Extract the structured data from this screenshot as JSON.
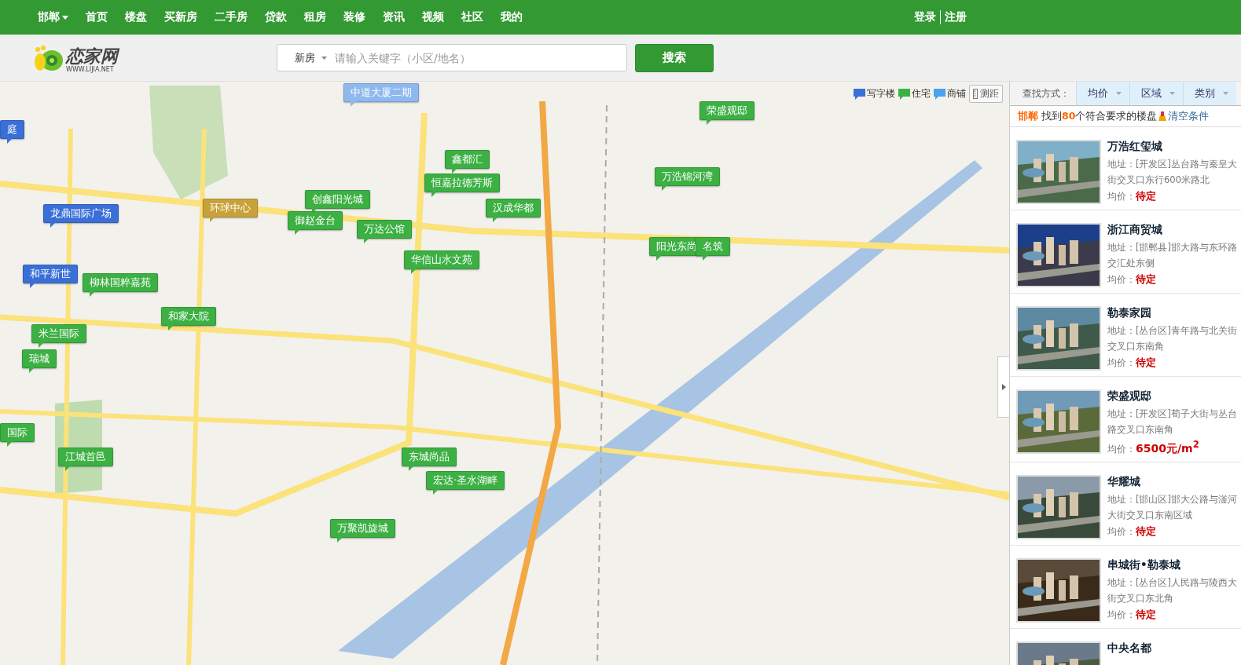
{
  "nav": {
    "city": "邯郸",
    "items": [
      "首页",
      "楼盘",
      "买新房",
      "二手房",
      "贷款",
      "租房",
      "装修",
      "资讯",
      "视频",
      "社区",
      "我的"
    ],
    "login": "登录",
    "register": "注册"
  },
  "header": {
    "logo": "恋家网",
    "logo_sub": "WWW.LIJIA.NET",
    "search_type": "新房",
    "placeholder": "请输入关键字（小区/地名）",
    "search_button": "搜索"
  },
  "map": {
    "legend": [
      {
        "label": "写字楼",
        "color": "#3a6fd8"
      },
      {
        "label": "住宅",
        "color": "#3cb043"
      },
      {
        "label": "商铺",
        "color": "#4aa3f0"
      }
    ],
    "measure": "测距",
    "markers": [
      {
        "label": "中道大厦二期",
        "color": "#8fb8ee"
      },
      {
        "label": "荣盛观邸",
        "color": "#3cb043"
      },
      {
        "label": "庭",
        "color": "#3a6fd8"
      },
      {
        "label": "万浩锦河湾",
        "color": "#3cb043"
      },
      {
        "label": "鑫都汇",
        "color": "#3cb043"
      },
      {
        "label": "恒嘉拉德芳斯",
        "color": "#3cb043"
      },
      {
        "label": "创鑫阳光城",
        "color": "#3cb043"
      },
      {
        "label": "环球中心",
        "color": "#c9a13a"
      },
      {
        "label": "龙鼎国际广场",
        "color": "#3a6fd8"
      },
      {
        "label": "汉成华都",
        "color": "#3cb043"
      },
      {
        "label": "御赵金台",
        "color": "#3cb043"
      },
      {
        "label": "万达公馆",
        "color": "#3cb043"
      },
      {
        "label": "阳光东尚",
        "color": "#3cb043"
      },
      {
        "label": "名筑",
        "color": "#3cb043"
      },
      {
        "label": "华信山水文苑",
        "color": "#3cb043"
      },
      {
        "label": "和平新世",
        "color": "#3a6fd8"
      },
      {
        "label": "柳林国粹嘉苑",
        "color": "#3cb043"
      },
      {
        "label": "和家大院",
        "color": "#3cb043"
      },
      {
        "label": "米兰国际",
        "color": "#3cb043"
      },
      {
        "label": "瑞城",
        "color": "#3cb043"
      },
      {
        "label": "国际",
        "color": "#3cb043"
      },
      {
        "label": "江城首邑",
        "color": "#3cb043"
      },
      {
        "label": "东城尚品",
        "color": "#3cb043"
      },
      {
        "label": "宏达·圣水湖畔",
        "color": "#3cb043"
      },
      {
        "label": "万聚凯旋城",
        "color": "#3cb043"
      }
    ]
  },
  "panel": {
    "find_label": "查找方式：",
    "filters": [
      "均价",
      "区域",
      "类别"
    ],
    "result_city": "邯郸",
    "result_pre": "找到",
    "result_count": "80",
    "result_post": "个符合要求的楼盘",
    "clear": "清空条件",
    "listings": [
      {
        "name": "万浩红玺城",
        "address": [
          "地址：[开发区]丛台路与秦皇大",
          "街交叉口东行600米路北"
        ],
        "price_label": "均价：",
        "price": "待定",
        "kind": "pending"
      },
      {
        "name": "浙江商贸城",
        "address": [
          "地址：[邯郸县]邯大路与东环路",
          "交汇处东侧"
        ],
        "price_label": "均价：",
        "price": "待定",
        "kind": "pending"
      },
      {
        "name": "勒泰家园",
        "address": [
          "地址：[丛台区]青年路与北关街",
          "交叉口东南角"
        ],
        "price_label": "均价：",
        "price": "待定",
        "kind": "pending"
      },
      {
        "name": "荣盛观邸",
        "address": [
          "地址：[开发区]荀子大街与丛台",
          "路交叉口东南角"
        ],
        "price_label": "均价：",
        "price": "6500元/m$^{2}$",
        "kind": "priced"
      },
      {
        "name": "华耀城",
        "address": [
          "地址：[邯山区]邯大公路与滏河",
          "大街交叉口东南区域"
        ],
        "price_label": "均价：",
        "price": "待定",
        "kind": "pending"
      },
      {
        "name": "串城街•勒泰城",
        "address": [
          "地址：[丛台区]人民路与陵西大",
          "街交叉口东北角"
        ],
        "price_label": "均价：",
        "price": "待定",
        "kind": "pending"
      },
      {
        "name": "中央名都",
        "kind": "cut"
      }
    ]
  }
}
